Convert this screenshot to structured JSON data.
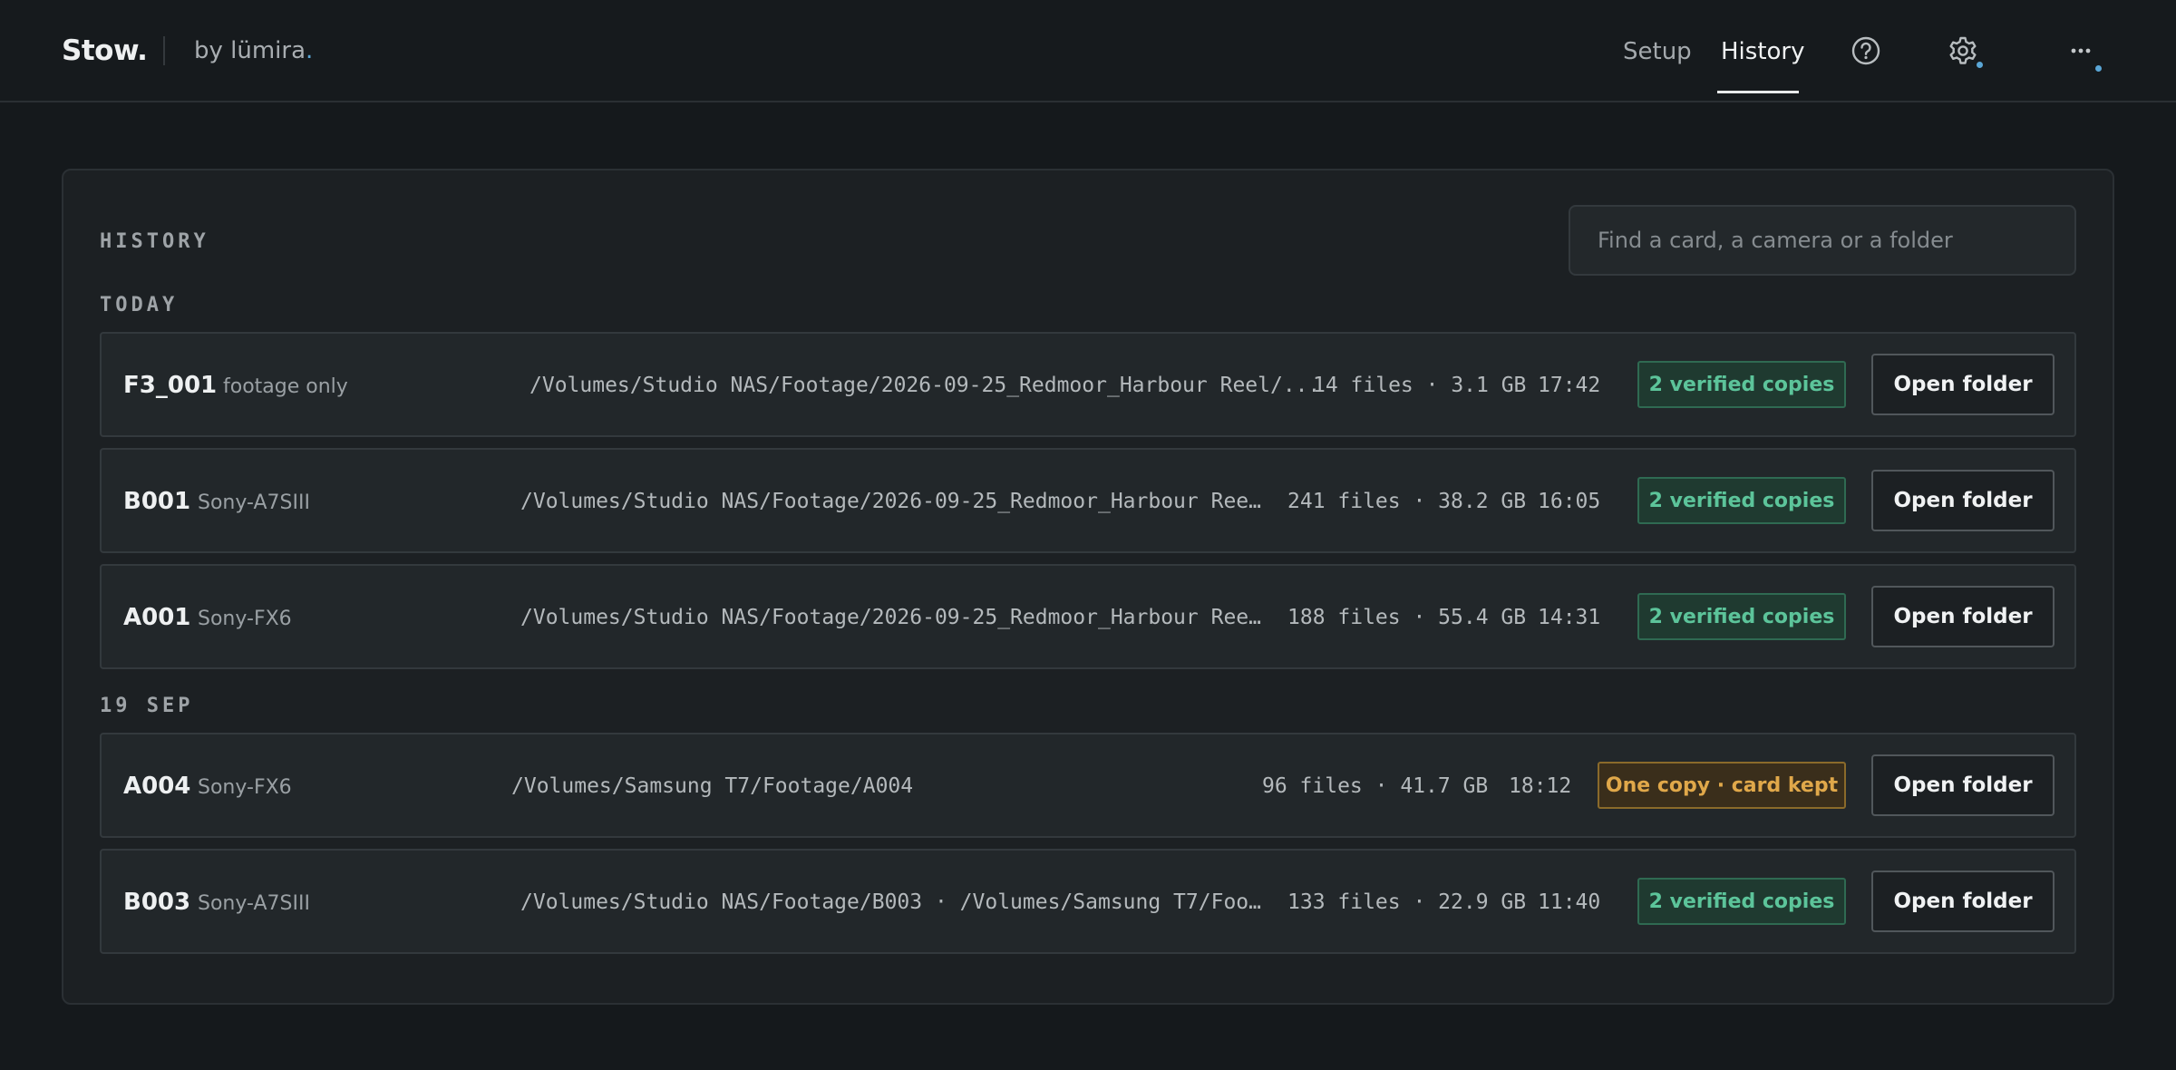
{
  "brand": {
    "name": "Stow.",
    "byline": "by lümira",
    "byline_dot": "."
  },
  "nav": {
    "setup": "Setup",
    "history": "History"
  },
  "icons": {
    "help": "question-circle-icon",
    "settings": "gear-icon",
    "more": "ellipsis-icon"
  },
  "colors": {
    "accent_dot": "#5aa6d6",
    "verified": "#5cc49a",
    "warning": "#e0a84a"
  },
  "history": {
    "title": "HISTORY",
    "search_placeholder": "Find a card, a camera or a folder",
    "open_label": "Open folder",
    "groups": [
      {
        "label": "TODAY",
        "rows": [
          {
            "id": "F3_001",
            "camera": "footage only",
            "path": "/Volumes/Studio NAS/Footage/2026-09-25_Redmoor_Harbour Reel/...",
            "stats": "14 files · 3.1 GB",
            "time": "17:42",
            "status": "2 verified copies"
          },
          {
            "id": "B001",
            "camera": "Sony-A7SIII",
            "path": "/Volumes/Studio NAS/Footage/2026-09-25_Redmoor_Harbour Reel...",
            "stats": "241 files · 38.2 GB",
            "time": "16:05",
            "status": "2 verified copies"
          },
          {
            "id": "A001",
            "camera": "Sony-FX6",
            "path": "/Volumes/Studio NAS/Footage/2026-09-25_Redmoor_Harbour Reel...",
            "stats": "188 files · 55.4 GB",
            "time": "14:31",
            "status": "2 verified copies"
          }
        ]
      },
      {
        "label": "19 SEP",
        "rows": [
          {
            "id": "A004",
            "camera": "Sony-FX6",
            "path": "/Volumes/Samsung T7/Footage/A004",
            "stats": "96 files · 41.7 GB",
            "time": "18:12",
            "status": "One copy · card kept"
          },
          {
            "id": "B003",
            "camera": "Sony-A7SIII",
            "path": "/Volumes/Studio NAS/Footage/B003 · /Volumes/Samsung T7/Foot...",
            "stats": "133 files · 22.9 GB",
            "time": "11:40",
            "status": "2 verified copies"
          }
        ]
      }
    ]
  }
}
